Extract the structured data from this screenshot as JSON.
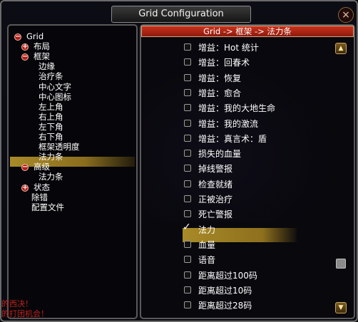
{
  "window": {
    "title": "Grid Configuration",
    "close_glyph": "×"
  },
  "tree": {
    "items": [
      {
        "label": "Grid",
        "toggle": "−"
      },
      {
        "label": "布局",
        "toggle": "+"
      },
      {
        "label": "框架",
        "toggle": "−"
      },
      {
        "label": "边缘"
      },
      {
        "label": "治疗条"
      },
      {
        "label": "中心文字"
      },
      {
        "label": "中心图标"
      },
      {
        "label": "左上角"
      },
      {
        "label": "右上角"
      },
      {
        "label": "左下角"
      },
      {
        "label": "右下角"
      },
      {
        "label": "框架透明度"
      },
      {
        "label": "法力条",
        "selected": true
      },
      {
        "label": "高级",
        "toggle": "−"
      },
      {
        "label": "法力条"
      },
      {
        "label": "状态",
        "toggle": "+"
      },
      {
        "label": "除错"
      },
      {
        "label": "配置文件"
      }
    ]
  },
  "breadcrumb": "Grid -> 框架 -> 法力条",
  "options": [
    {
      "label": "增益：Hot 统计",
      "checked": false
    },
    {
      "label": "增益：回春术",
      "checked": false
    },
    {
      "label": "增益：恢复",
      "checked": false
    },
    {
      "label": "增益：愈合",
      "checked": false
    },
    {
      "label": "增益：我的大地生命",
      "checked": false
    },
    {
      "label": "增益：我的激流",
      "checked": false
    },
    {
      "label": "增益：真言术：盾",
      "checked": false
    },
    {
      "label": "损失的血量",
      "checked": false
    },
    {
      "label": "掉线警报",
      "checked": false
    },
    {
      "label": "检查就绪",
      "checked": false
    },
    {
      "label": "正被治疗",
      "checked": false
    },
    {
      "label": "死亡警报",
      "checked": false
    },
    {
      "label": "法力",
      "checked": true
    },
    {
      "label": "血量",
      "checked": false
    },
    {
      "label": "语音",
      "checked": false
    },
    {
      "label": "距离超过100码",
      "checked": false
    },
    {
      "label": "距离超过10码",
      "checked": false
    },
    {
      "label": "距离超过28码",
      "checked": false
    }
  ],
  "checkmark_glyph": "✓",
  "scroll": {
    "up_glyph": "▲",
    "down_glyph": "▼"
  },
  "chat": {
    "line1": "的西决！",
    "line2": "的打团机会！"
  },
  "colors": {
    "accent_gold": "#a88a28",
    "breadcrumb_red": "#b8281a",
    "toggle_red": "#b81a12"
  }
}
